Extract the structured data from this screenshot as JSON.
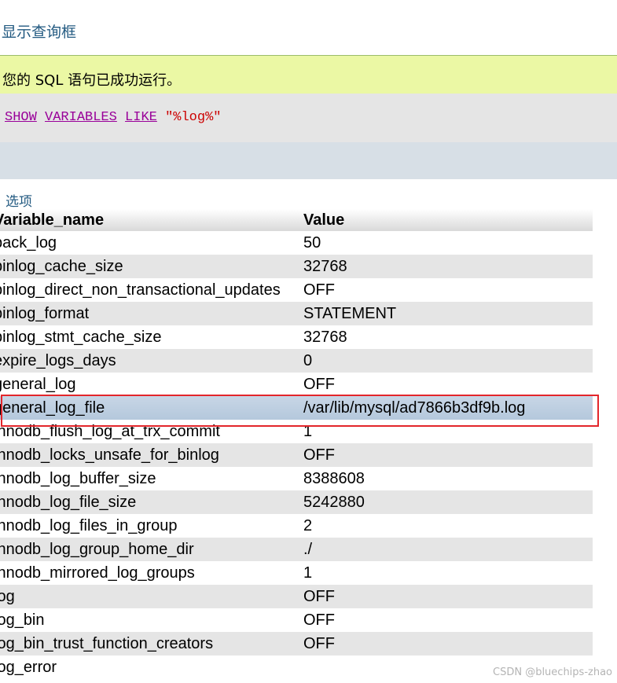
{
  "header": {
    "show_query_box_label": "显示查询框"
  },
  "message": {
    "success_text": "您的 SQL 语句已成功运行。"
  },
  "sql": {
    "kw_show": "SHOW",
    "kw_variables": "VARIABLES",
    "kw_like": "LIKE",
    "pattern": "\"%log%\""
  },
  "results": {
    "options_label": "选项",
    "columns": [
      "Variable_name",
      "Value"
    ],
    "rows": [
      [
        "back_log",
        "50"
      ],
      [
        "binlog_cache_size",
        "32768"
      ],
      [
        "binlog_direct_non_transactional_updates",
        "OFF"
      ],
      [
        "binlog_format",
        "STATEMENT"
      ],
      [
        "binlog_stmt_cache_size",
        "32768"
      ],
      [
        "expire_logs_days",
        "0"
      ],
      [
        "general_log",
        "OFF"
      ],
      [
        "general_log_file",
        "/var/lib/mysql/ad7866b3df9b.log"
      ],
      [
        "innodb_flush_log_at_trx_commit",
        "1"
      ],
      [
        "innodb_locks_unsafe_for_binlog",
        "OFF"
      ],
      [
        "innodb_log_buffer_size",
        "8388608"
      ],
      [
        "innodb_log_file_size",
        "5242880"
      ],
      [
        "innodb_log_files_in_group",
        "2"
      ],
      [
        "innodb_log_group_home_dir",
        "./"
      ],
      [
        "innodb_mirrored_log_groups",
        "1"
      ],
      [
        "log",
        "OFF"
      ],
      [
        "log_bin",
        "OFF"
      ],
      [
        "log_bin_trust_function_creators",
        "OFF"
      ],
      [
        "log_error",
        ""
      ]
    ],
    "selected_row_index": 7
  },
  "colors": {
    "link": "#235a81",
    "success_bg": "#ebf8a4",
    "keyword": "#990099",
    "string": "#cc0000",
    "highlight_border": "#e3262b"
  },
  "watermark": "CSDN @bluechips-zhao"
}
